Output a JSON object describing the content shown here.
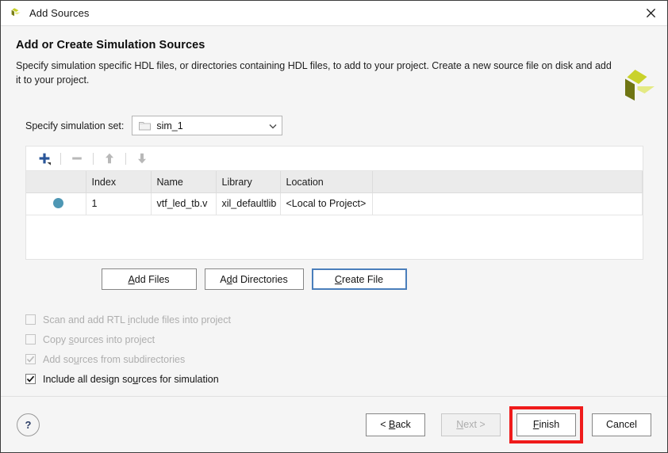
{
  "window": {
    "title": "Add Sources",
    "icon": "vivado-logo-icon",
    "close_label": "✕"
  },
  "header": {
    "heading": "Add or Create Simulation Sources",
    "description": "Specify simulation specific HDL files, or directories containing HDL files, to add to your project. Create a new source file on disk and add it to your project.",
    "brand_icon": "xilinx-logo-icon"
  },
  "simset": {
    "label": "Specify simulation set:",
    "value": "sim_1",
    "icon": "folder-icon",
    "arrow_icon": "chevron-down-icon"
  },
  "toolbar": {
    "add_icon": "plus-icon",
    "remove_icon": "minus-icon",
    "move_up_icon": "arrow-up-icon",
    "move_down_icon": "arrow-down-icon"
  },
  "table": {
    "columns": [
      "",
      "Index",
      "Name",
      "Library",
      "Location"
    ],
    "rows": [
      {
        "status": "●",
        "index": "1",
        "name": "vtf_led_tb.v",
        "library": "xil_defaultlib",
        "location": "<Local to Project>"
      }
    ]
  },
  "file_buttons": {
    "add_files": "Add Files",
    "add_files_mnemonic": "A",
    "add_files_rest": "dd Files",
    "add_directories_pre": "A",
    "add_directories_mnemonic": "d",
    "add_directories_rest": "d Directories",
    "create_file_mnemonic": "C",
    "create_file_rest": "reate File"
  },
  "options": [
    {
      "pre": "Scan and add RTL ",
      "mnemonic": "i",
      "rest": "nclude files into project",
      "checked": false,
      "enabled": false
    },
    {
      "pre": "Copy ",
      "mnemonic": "s",
      "rest": "ources into project",
      "checked": false,
      "enabled": false
    },
    {
      "pre": "Add so",
      "mnemonic": "u",
      "rest": "rces from subdirectories",
      "checked": true,
      "enabled": false
    },
    {
      "pre": "Include all design so",
      "mnemonic": "u",
      "rest": "rces for simulation",
      "checked": true,
      "enabled": true
    }
  ],
  "footer": {
    "help_label": "?",
    "back_pre": "< ",
    "back_mnemonic": "B",
    "back_rest": "ack",
    "next_mnemonic": "N",
    "next_rest": "ext >",
    "finish_mnemonic": "F",
    "finish_rest": "inish",
    "cancel_label": "Cancel"
  },
  "colors": {
    "accent_blue": "#4a7ebb",
    "row_dot": "#4e97b4",
    "highlight_red": "#ef1b1b",
    "logo_dark": "#7a7f16",
    "logo_mid": "#c6cf28",
    "logo_light": "#e3e97e"
  }
}
